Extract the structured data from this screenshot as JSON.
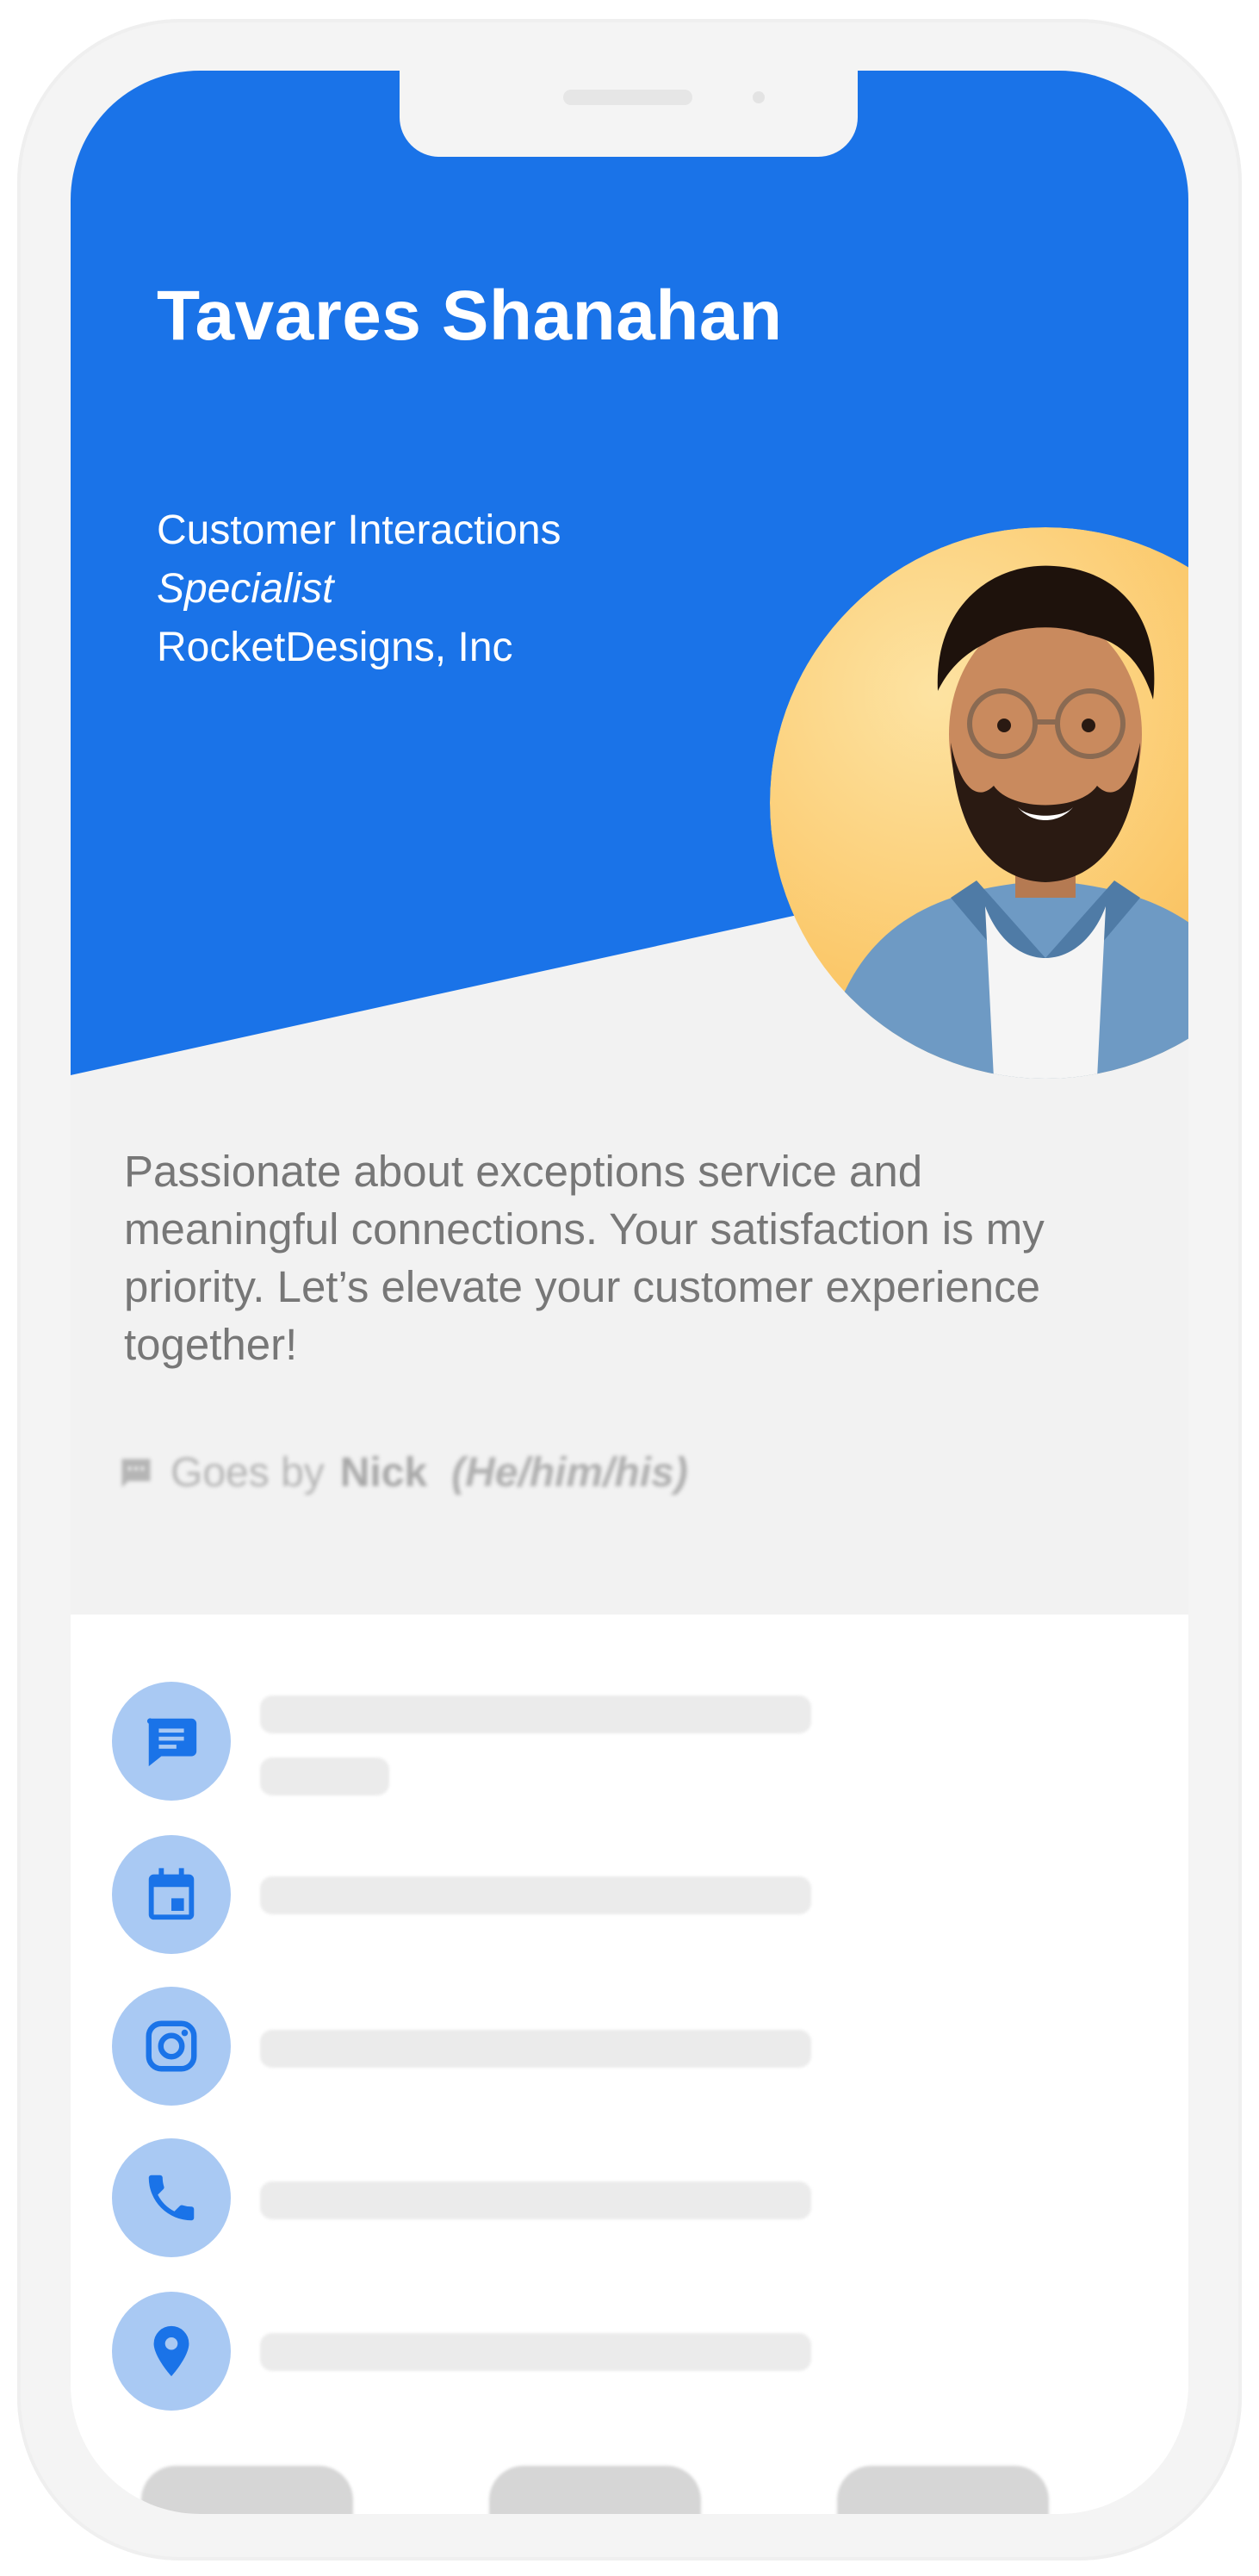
{
  "profile": {
    "name": "Tavares Shanahan",
    "role_line1": "Customer Interactions",
    "role_line2": "Specialist",
    "company": "RocketDesigns, Inc",
    "bio": "Passionate about exceptions service and meaningful connections. Your satisfaction is my priority. Let’s elevate your customer experience together!"
  },
  "pronouns": {
    "prefix": "Goes by",
    "nickname": "Nick",
    "pronouns": "(He/him/his)"
  },
  "contacts": [
    {
      "icon": "message-icon"
    },
    {
      "icon": "calendar-icon"
    },
    {
      "icon": "instagram-icon"
    },
    {
      "icon": "phone-icon"
    },
    {
      "icon": "location-pin-icon"
    }
  ],
  "colors": {
    "brand_blue": "#1a73e8",
    "icon_circle": "#a9c9f3",
    "avatar_bg": "#fbc86a",
    "bio_text": "#777777"
  }
}
